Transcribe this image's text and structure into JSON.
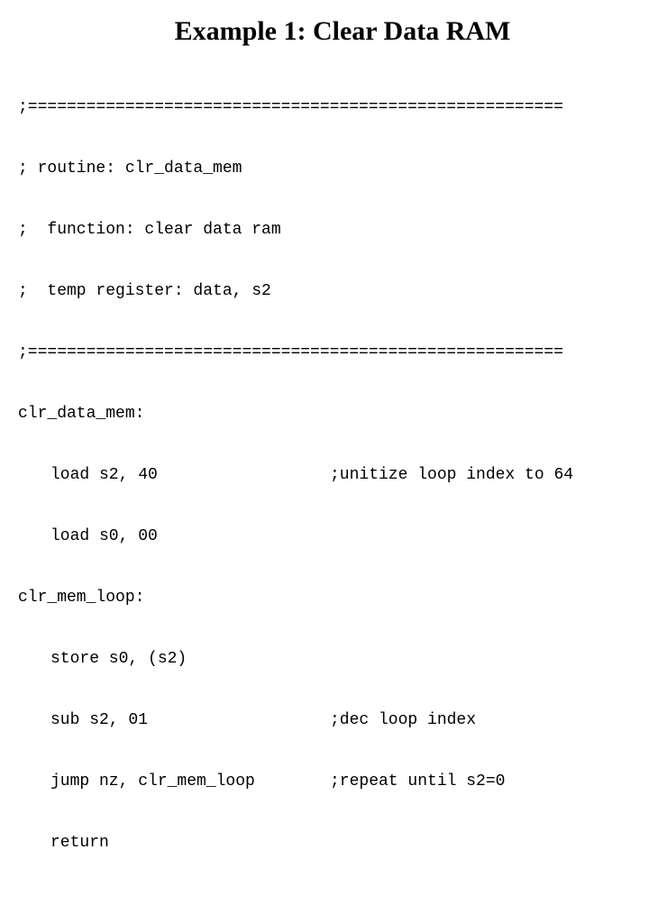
{
  "title": "Example 1: Clear Data RAM",
  "lines": {
    "l0": ";=======================================================",
    "l1": "; routine: clr_data_mem",
    "l2": ";  function: clear data ram",
    "l3": ";  temp register: data, s2",
    "l4": ";=======================================================",
    "l5": "clr_data_mem:",
    "l6_left": "load s2, 40",
    "l6_right": ";unitize loop index to 64",
    "l7": "load s0, 00",
    "l8": "clr_mem_loop:",
    "l9": "store s0, (s2)",
    "l10_left": "sub s2, 01",
    "l10_right": ";dec loop index",
    "l11_left": "jump nz, clr_mem_loop",
    "l11_right": ";repeat until s2=0",
    "l12": "return"
  }
}
